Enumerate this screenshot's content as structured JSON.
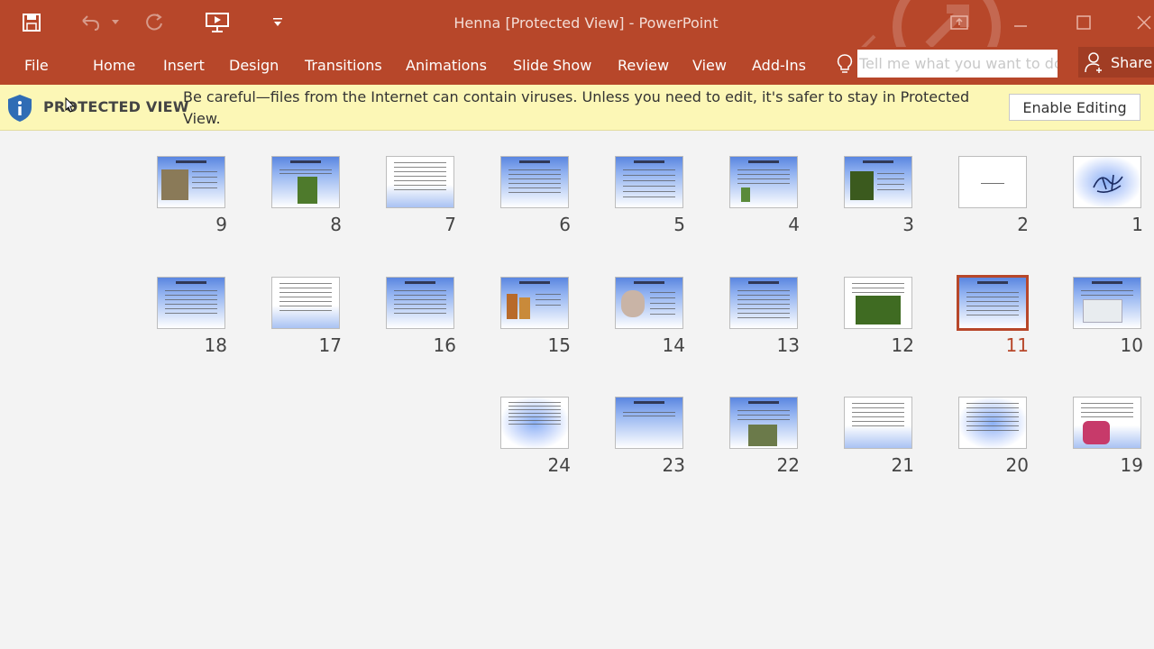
{
  "app": {
    "title": "Henna [Protected View] - PowerPoint"
  },
  "ribbon": {
    "tabs": [
      "File",
      "Home",
      "Insert",
      "Design",
      "Transitions",
      "Animations",
      "Slide Show",
      "Review",
      "View",
      "Add-Ins"
    ],
    "tell_me_placeholder": "Tell me what you want to do",
    "share_label": "Share"
  },
  "protected_view": {
    "title": "PROTECTED VIEW",
    "message": "Be careful—files from the Internet can contain viruses. Unless you need to edit, it's safer to stay in Protected View.",
    "button": "Enable Editing"
  },
  "slides": {
    "selected": "11",
    "numbers": [
      "1",
      "2",
      "3",
      "4",
      "5",
      "6",
      "7",
      "8",
      "9",
      "10",
      "11",
      "12",
      "13",
      "14",
      "15",
      "16",
      "17",
      "18",
      "19",
      "20",
      "21",
      "22",
      "23",
      "24"
    ]
  },
  "colors": {
    "accent": "#b7472a",
    "protected_bar": "#fcf7b6"
  }
}
